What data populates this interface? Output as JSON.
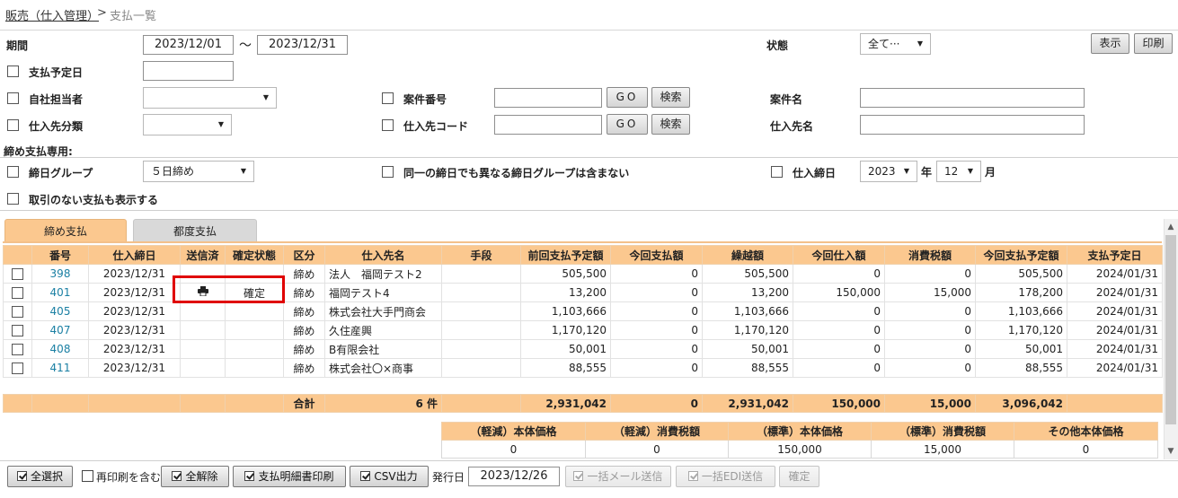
{
  "breadcrumb": {
    "parent": "販売（仕入管理）",
    "separator": ">",
    "current": "支払一覧"
  },
  "filters": {
    "period_label": "期間",
    "period_from": "2023/12/01",
    "period_to": "2023/12/31",
    "period_tilde": "～",
    "status_label": "状態",
    "status_value": "全て···",
    "show_button": "表示",
    "print_button": "印刷",
    "pay_due_label": "支払予定日",
    "staff_label": "自社担当者",
    "case_no_label": "案件番号",
    "go_label": "GO",
    "search_label": "検索",
    "case_name_label": "案件名",
    "supplier_class_label": "仕入先分類",
    "supplier_code_label": "仕入先コード",
    "supplier_name_label": "仕入先名",
    "closing_only_label": "締め支払専用:",
    "closing_group_label": "締日グループ",
    "closing_group_value": "５日締め",
    "exclude_other_groups_label": "同一の締日でも異なる締日グループは含まない",
    "purchase_close_label": "仕入締日",
    "year_value": "2023",
    "year_unit": "年",
    "month_value": "12",
    "month_unit": "月",
    "show_no_txn_label": "取引のない支払も表示する"
  },
  "tabs": [
    "締め支払",
    "都度支払"
  ],
  "table": {
    "headers": [
      "",
      "番号",
      "仕入締日",
      "送信済",
      "確定状態",
      "区分",
      "仕入先名",
      "手段",
      "前回支払予定額",
      "今回支払額",
      "繰越額",
      "今回仕入額",
      "消費税額",
      "今回支払予定額",
      "支払予定日"
    ],
    "rows": [
      {
        "no": "398",
        "close": "2023/12/31",
        "sent": "",
        "confirm": "",
        "kubun": "締め",
        "name": "法人　福岡テスト2",
        "method": "",
        "prev": "505,500",
        "paid": "0",
        "carry": "505,500",
        "purchase": "0",
        "tax": "0",
        "due_amt": "505,500",
        "due_date": "2024/01/31"
      },
      {
        "no": "401",
        "close": "2023/12/31",
        "sent": "printer-icon",
        "confirm": "確定",
        "kubun": "締め",
        "name": "福岡テスト4",
        "method": "",
        "prev": "13,200",
        "paid": "0",
        "carry": "13,200",
        "purchase": "150,000",
        "tax": "15,000",
        "due_amt": "178,200",
        "due_date": "2024/01/31"
      },
      {
        "no": "405",
        "close": "2023/12/31",
        "sent": "",
        "confirm": "",
        "kubun": "締め",
        "name": "株式会社大手門商会",
        "method": "",
        "prev": "1,103,666",
        "paid": "0",
        "carry": "1,103,666",
        "purchase": "0",
        "tax": "0",
        "due_amt": "1,103,666",
        "due_date": "2024/01/31"
      },
      {
        "no": "407",
        "close": "2023/12/31",
        "sent": "",
        "confirm": "",
        "kubun": "締め",
        "name": "久住産興",
        "method": "",
        "prev": "1,170,120",
        "paid": "0",
        "carry": "1,170,120",
        "purchase": "0",
        "tax": "0",
        "due_amt": "1,170,120",
        "due_date": "2024/01/31"
      },
      {
        "no": "408",
        "close": "2023/12/31",
        "sent": "",
        "confirm": "",
        "kubun": "締め",
        "name": "B有限会社",
        "method": "",
        "prev": "50,001",
        "paid": "0",
        "carry": "50,001",
        "purchase": "0",
        "tax": "0",
        "due_amt": "50,001",
        "due_date": "2024/01/31"
      },
      {
        "no": "411",
        "close": "2023/12/31",
        "sent": "",
        "confirm": "",
        "kubun": "締め",
        "name": "株式会社〇×商事",
        "method": "",
        "prev": "88,555",
        "paid": "0",
        "carry": "88,555",
        "purchase": "0",
        "tax": "0",
        "due_amt": "88,555",
        "due_date": "2024/01/31"
      }
    ]
  },
  "totals": {
    "label": "合計",
    "count": "6 件",
    "prev": "2,931,042",
    "paid": "0",
    "carry": "2,931,042",
    "purchase": "150,000",
    "tax": "15,000",
    "due_amt": "3,096,042"
  },
  "tax_breakdown": {
    "headers": [
      "（軽減）本体価格",
      "（軽減）消費税額",
      "（標準）本体価格",
      "（標準）消費税額",
      "その他本体価格"
    ],
    "values": [
      "0",
      "0",
      "150,000",
      "15,000",
      "0"
    ]
  },
  "bottom": {
    "select_all": "全選択",
    "include_reprint": "再印刷を含む",
    "deselect_all": "全解除",
    "print_statement": "支払明細書印刷",
    "csv": "CSV出力",
    "issue_date_label": "発行日",
    "issue_date": "2023/12/26",
    "bulk_mail": "一括メール送信",
    "bulk_edi": "一括EDI送信",
    "confirm": "確定"
  },
  "colors": {
    "header_orange": "#fbc88f",
    "link": "#1a7fa3",
    "highlight": "#e00000"
  }
}
